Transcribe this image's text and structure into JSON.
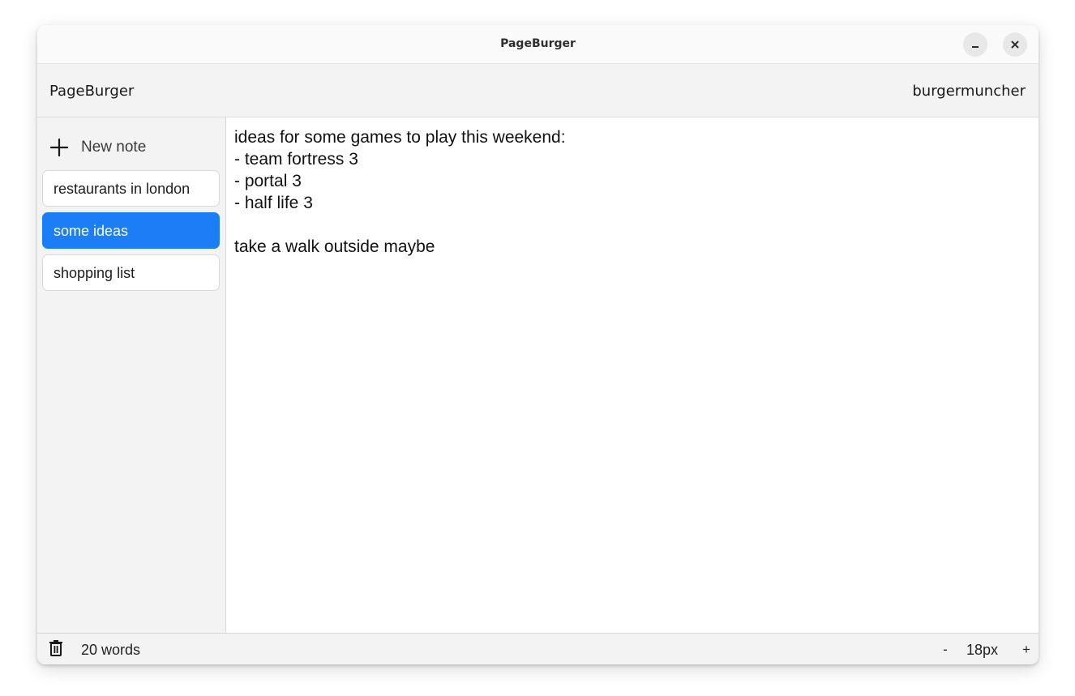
{
  "window": {
    "title": "PageBurger",
    "controls": {
      "minimize_icon": "minimize-icon",
      "close_icon": "close-icon"
    }
  },
  "header": {
    "app_name": "PageBurger",
    "username": "burgermuncher"
  },
  "sidebar": {
    "new_note_label": "New note",
    "new_note_icon": "plus-icon",
    "notes": [
      {
        "title": "restaurants in london",
        "active": false
      },
      {
        "title": "some ideas",
        "active": true
      },
      {
        "title": "shopping list",
        "active": false
      }
    ]
  },
  "editor": {
    "content": "ideas for some games to play this weekend:\n- team fortress 3\n- portal 3\n- half life 3\n\ntake a walk outside maybe"
  },
  "status": {
    "delete_icon": "trash-icon",
    "word_count": "20 words",
    "font_decrease_label": "-",
    "font_size": "18px",
    "font_increase_label": "+"
  },
  "colors": {
    "accent": "#1c7ef7",
    "panel_bg": "#f3f3f3"
  }
}
